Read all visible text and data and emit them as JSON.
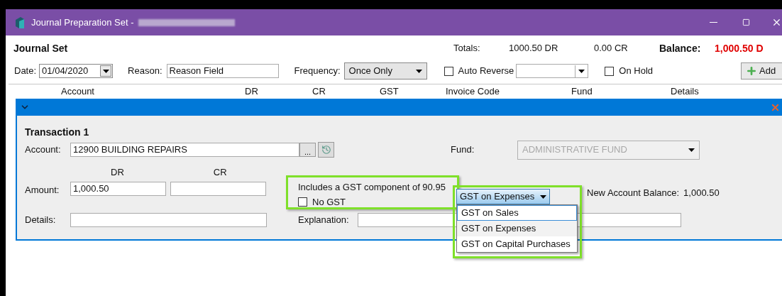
{
  "window": {
    "title": "Journal Preparation Set -"
  },
  "header": {
    "title": "Journal Set",
    "totals_label": "Totals:",
    "total_dr": "1000.50 DR",
    "total_cr": "0.00 CR",
    "balance_label": "Balance:",
    "balance": "1,000.50 D"
  },
  "toolbar": {
    "date_label": "Date:",
    "date": "01/04/2020",
    "reason_label": "Reason:",
    "reason": "Reason Field",
    "frequency_label": "Frequency:",
    "frequency": "Once Only",
    "auto_reverse": {
      "label": "Auto Reverse",
      "checked": false
    },
    "on_hold": {
      "label": "On Hold",
      "checked": false
    },
    "add_button": "Add"
  },
  "table": {
    "columns": [
      "Account",
      "DR",
      "CR",
      "GST",
      "Invoice Code",
      "Fund",
      "Details"
    ],
    "row": {
      "expanded": true
    }
  },
  "transaction": {
    "title": "Transaction 1",
    "account_label": "Account:",
    "account": "12900 BUILDING REPAIRS",
    "browse_button": "...",
    "fund_label": "Fund:",
    "fund": {
      "value": "ADMINISTRATIVE FUND",
      "disabled": true
    },
    "dr_label": "DR",
    "cr_label": "CR",
    "amount_label": "Amount:",
    "amount_dr": "1,000.50",
    "gst_note": "Includes a GST component of 90.95",
    "no_gst": {
      "label": "No GST",
      "checked": false
    },
    "gst_select": "GST on Expenses",
    "new_balance_label": "New Account Balance:",
    "new_balance": "1,000.50",
    "details_label": "Details:",
    "explanation_label": "Explanation:",
    "gst_options": [
      {
        "label": "GST on Sales",
        "selected": true
      },
      {
        "label": "GST on Expenses",
        "selected": false
      },
      {
        "label": "GST on Capital Purchases",
        "selected": false
      }
    ]
  }
}
